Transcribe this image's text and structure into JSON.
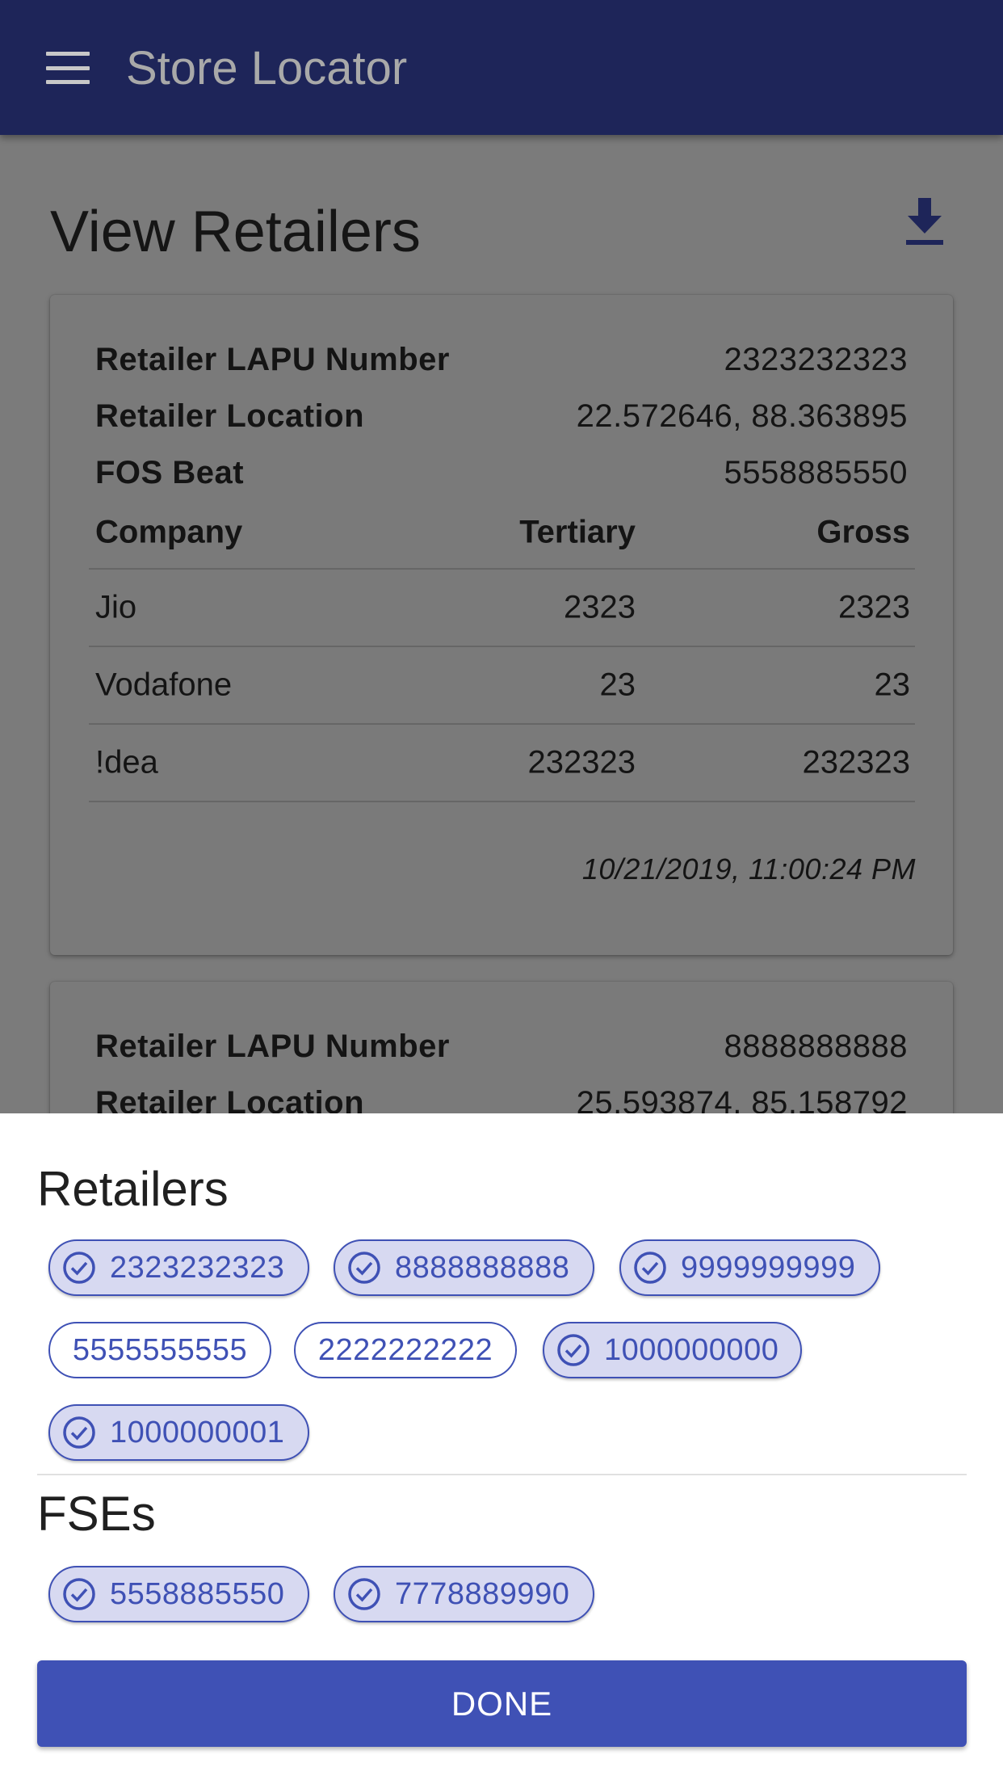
{
  "app_bar": {
    "title": "Store Locator",
    "menu_icon": "menu-icon"
  },
  "page": {
    "title": "View Retailers",
    "download_icon": "download-icon"
  },
  "cards": [
    {
      "fields": [
        {
          "label": "Retailer LAPU Number",
          "value": "2323232323"
        },
        {
          "label": "Retailer Location",
          "value": "22.572646, 88.363895"
        },
        {
          "label": "FOS Beat",
          "value": "5558885550"
        }
      ],
      "table": {
        "headers": [
          "Company",
          "Tertiary",
          "Gross"
        ],
        "rows": [
          [
            "Jio",
            "2323",
            "2323"
          ],
          [
            "Vodafone",
            "23",
            "23"
          ],
          [
            "!dea",
            "232323",
            "232323"
          ]
        ]
      },
      "timestamp": "10/21/2019, 11:00:24 PM"
    },
    {
      "fields": [
        {
          "label": "Retailer LAPU Number",
          "value": "8888888888"
        },
        {
          "label": "Retailer Location",
          "value": "25.593874, 85.158792"
        }
      ]
    }
  ],
  "sheet": {
    "retailers_title": "Retailers",
    "retailers": [
      {
        "label": "2323232323",
        "selected": true
      },
      {
        "label": "8888888888",
        "selected": true
      },
      {
        "label": "9999999999",
        "selected": true
      },
      {
        "label": "5555555555",
        "selected": false
      },
      {
        "label": "2222222222",
        "selected": false
      },
      {
        "label": "1000000000",
        "selected": true
      },
      {
        "label": "1000000001",
        "selected": true
      }
    ],
    "fses_title": "FSEs",
    "fses": [
      {
        "label": "5558885550",
        "selected": true
      },
      {
        "label": "7778889990",
        "selected": true
      }
    ],
    "done_label": "DONE"
  },
  "colors": {
    "app_bar": "#1e2559",
    "accent": "#3f51b5",
    "chip_selected_bg": "#d7d9f1"
  }
}
